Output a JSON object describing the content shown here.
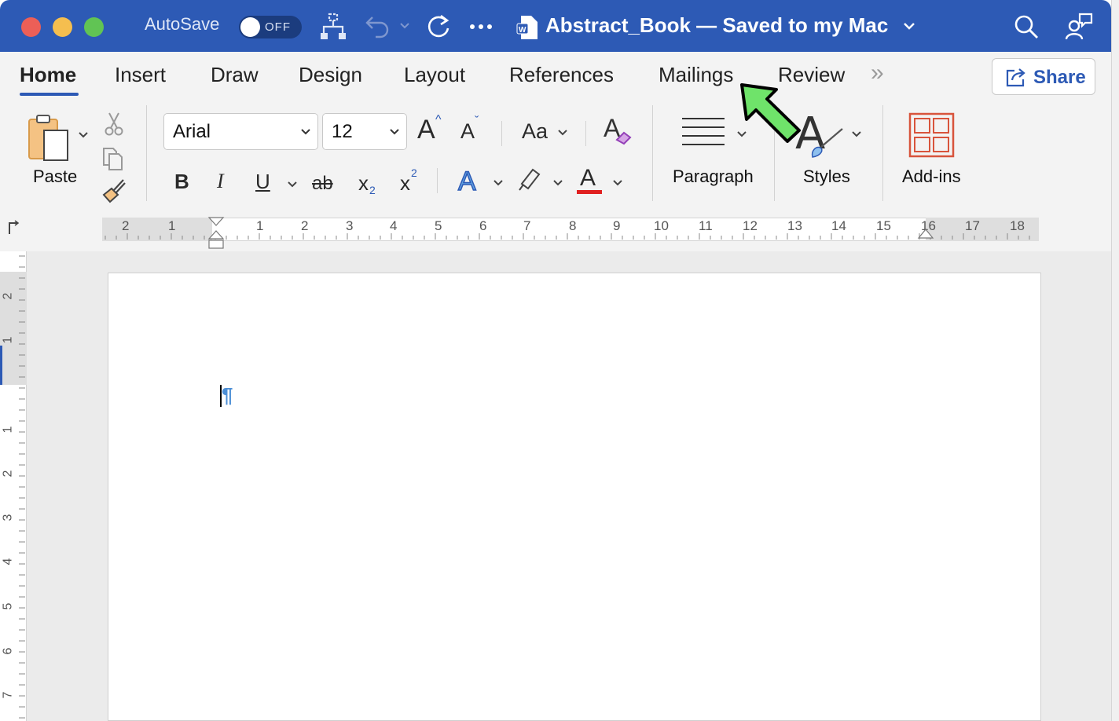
{
  "titlebar": {
    "autosave_label": "AutoSave",
    "autosave_state": "OFF",
    "document_title": "Abstract_Book — Saved to my Mac",
    "colors": {
      "bar": "#2d5ab5",
      "close": "#ec5f57",
      "minimize": "#f5be4f",
      "zoom": "#61c454"
    }
  },
  "ribbon": {
    "tabs": [
      {
        "label": "Home",
        "active": true
      },
      {
        "label": "Insert"
      },
      {
        "label": "Draw"
      },
      {
        "label": "Design"
      },
      {
        "label": "Layout"
      },
      {
        "label": "References"
      },
      {
        "label": "Mailings"
      },
      {
        "label": "Review"
      }
    ],
    "more_tabs_glyph": "»",
    "share_label": "Share",
    "paste_label": "Paste",
    "font_name": "Arial",
    "font_size": "12",
    "grow_font": "A",
    "shrink_font": "A",
    "change_case": "Aa",
    "bold": "B",
    "italic": "I",
    "underline": "U",
    "strikethrough": "ab",
    "subscript_base": "x",
    "subscript_mark": "2",
    "superscript_base": "x",
    "superscript_mark": "2",
    "text_effects": "A",
    "font_color": "A",
    "paragraph_label": "Paragraph",
    "styles_label": "Styles",
    "styles_glyph": "A",
    "addins_label": "Add-ins",
    "colors": {
      "accent": "#2d5ab5",
      "font_color_bar": "#e02020",
      "addins": "#d8543c",
      "annotation_arrow": "#6fe36a"
    }
  },
  "ruler": {
    "horizontal": [
      "2",
      "1",
      "1",
      "2",
      "3",
      "4",
      "5",
      "6",
      "7",
      "8",
      "9",
      "10",
      "11",
      "12",
      "13",
      "14",
      "15",
      "16",
      "17",
      "18"
    ],
    "vertical": [
      "2",
      "1",
      "1",
      "2",
      "3",
      "4",
      "5",
      "6",
      "7"
    ]
  },
  "document": {
    "paragraph_mark": "¶"
  }
}
